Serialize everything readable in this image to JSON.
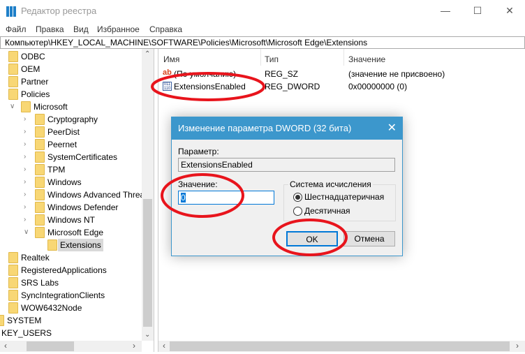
{
  "window": {
    "title": "Редактор реестра",
    "icon": "regedit-icon"
  },
  "menu": [
    "Файл",
    "Правка",
    "Вид",
    "Избранное",
    "Справка"
  ],
  "address": "Компьютер\\HKEY_LOCAL_MACHINE\\SOFTWARE\\Policies\\Microsoft\\Microsoft Edge\\Extensions",
  "tree": [
    {
      "label": "ODBC",
      "level": 1
    },
    {
      "label": "OEM",
      "level": 1
    },
    {
      "label": "Partner",
      "level": 1
    },
    {
      "label": "Policies",
      "level": 1
    },
    {
      "label": "Microsoft",
      "level": 2,
      "expanded": true
    },
    {
      "label": "Cryptography",
      "level": 3,
      "chevron": true
    },
    {
      "label": "PeerDist",
      "level": 3,
      "chevron": true
    },
    {
      "label": "Peernet",
      "level": 3,
      "chevron": true
    },
    {
      "label": "SystemCertificates",
      "level": 3,
      "chevron": true
    },
    {
      "label": "TPM",
      "level": 3,
      "chevron": true
    },
    {
      "label": "Windows",
      "level": 3,
      "chevron": true
    },
    {
      "label": "Windows Advanced Threa",
      "level": 3,
      "chevron": true
    },
    {
      "label": "Windows Defender",
      "level": 3,
      "chevron": true
    },
    {
      "label": "Windows NT",
      "level": 3,
      "chevron": true
    },
    {
      "label": "Microsoft Edge",
      "level": 3,
      "expanded": true
    },
    {
      "label": "Extensions",
      "level": 4,
      "selected": true
    },
    {
      "label": "Realtek",
      "level": 1
    },
    {
      "label": "RegisteredApplications",
      "level": 1
    },
    {
      "label": "SRS Labs",
      "level": 1
    },
    {
      "label": "SyncIntegrationClients",
      "level": 1
    },
    {
      "label": "WOW6432Node",
      "level": 1
    },
    {
      "label": "SYSTEM",
      "level": 0
    },
    {
      "label": "KEY_USERS",
      "level": -1
    }
  ],
  "list": {
    "columns": [
      "Имя",
      "Тип",
      "Значение"
    ],
    "rows": [
      {
        "name": "(По умолчанию)",
        "type": "REG_SZ",
        "value": "(значение не присвоено)",
        "icon": "string-value-icon"
      },
      {
        "name": "ExtensionsEnabled",
        "type": "REG_DWORD",
        "value": "0x00000000 (0)",
        "icon": "dword-value-icon"
      }
    ]
  },
  "dialog": {
    "title": "Изменение параметра DWORD (32 бита)",
    "param_label": "Параметр:",
    "param_value": "ExtensionsEnabled",
    "value_label": "Значение:",
    "value": "0",
    "base_group": "Система исчисления",
    "base_options": [
      "Шестнадцатеричная",
      "Десятичная"
    ],
    "base_selected": "Шестнадцатеричная",
    "ok": "OK",
    "cancel": "Отмена"
  },
  "colors": {
    "accent": "#3c97cc",
    "annotation": "#e8141c",
    "folder": "#f8d775"
  }
}
